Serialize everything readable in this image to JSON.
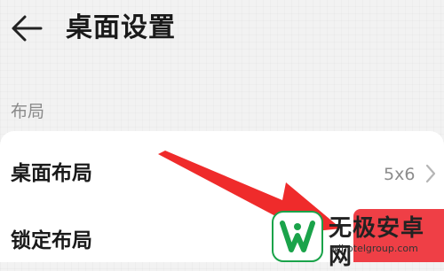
{
  "header": {
    "title": "桌面设置",
    "back_icon": "arrow-left-icon"
  },
  "section": {
    "label": "布局"
  },
  "settings": {
    "desktop_layout": {
      "label": "桌面布局",
      "value": "5x6"
    },
    "lock_layout": {
      "label": "锁定布局",
      "toggle_color": "#ef3f46"
    }
  },
  "annotation": {
    "arrow_color": "#ef2b2b"
  },
  "watermark": {
    "name": "无极安卓网",
    "url": "wjhotelgroup.com",
    "logo_color": "#1aa34a"
  }
}
